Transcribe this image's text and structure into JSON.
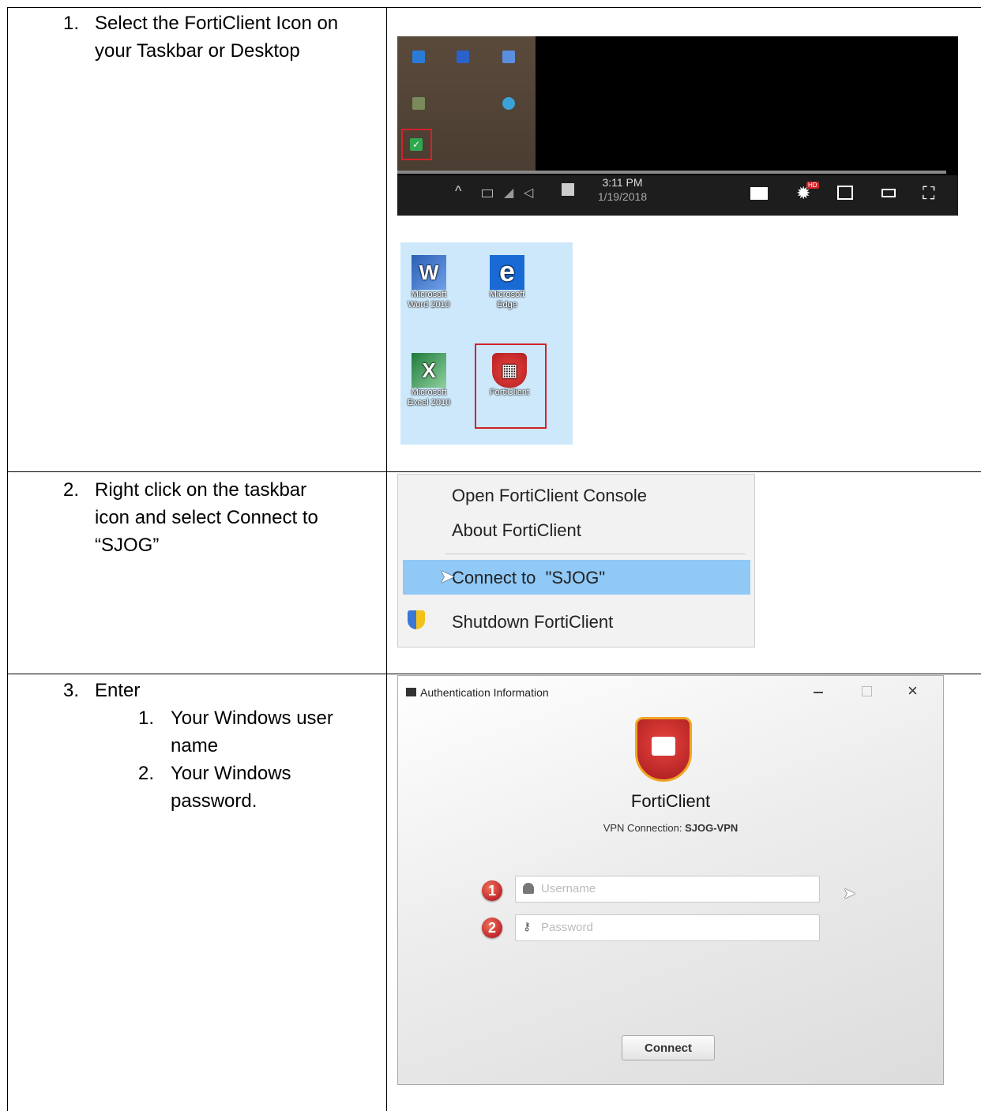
{
  "steps": [
    {
      "number": "1.",
      "text_line1": "Select the FortiClient Icon on",
      "text_line2": "your Taskbar or Desktop"
    },
    {
      "number": "2.",
      "text_line1": "Right click on the taskbar",
      "text_line2": "icon and select Connect to",
      "text_line3": "“SJOG”"
    },
    {
      "number": "3.",
      "text": "Enter",
      "subitems": [
        {
          "number": "1.",
          "line1": "Your Windows user",
          "line2": "name"
        },
        {
          "number": "2.",
          "line1": "Your Windows",
          "line2": "password."
        }
      ]
    }
  ],
  "taskbar": {
    "time": "3:11 PM",
    "date": "1/19/2018",
    "hd_badge": "HD"
  },
  "desktop_icons": [
    {
      "line1": "Microsoft",
      "line2": "Word 2010",
      "icon": "word-icon"
    },
    {
      "line1": "Microsoft",
      "line2": "Edge",
      "icon": "edge-icon"
    },
    {
      "line1": "Microsoft",
      "line2": "Excel 2010",
      "icon": "excel-icon"
    },
    {
      "line1": "FortiClient",
      "line2": "",
      "icon": "forticlient-icon"
    }
  ],
  "context_menu": {
    "items": [
      "Open FortiClient Console",
      "About FortiClient",
      "Connect to  \"SJOG\"",
      "Shutdown FortiClient"
    ]
  },
  "auth_dialog": {
    "title": "Authentication Information",
    "brand": "FortiClient",
    "vpn_label": "VPN Connection:",
    "vpn_name": "SJOG-VPN",
    "username_placeholder": "Username",
    "password_placeholder": "Password",
    "badge1": "1",
    "badge2": "2",
    "connect_label": "Connect"
  },
  "colors": {
    "highlight": "#90c8f6",
    "forti_red": "#d0232a",
    "desktop_bg": "#cde8fb"
  }
}
